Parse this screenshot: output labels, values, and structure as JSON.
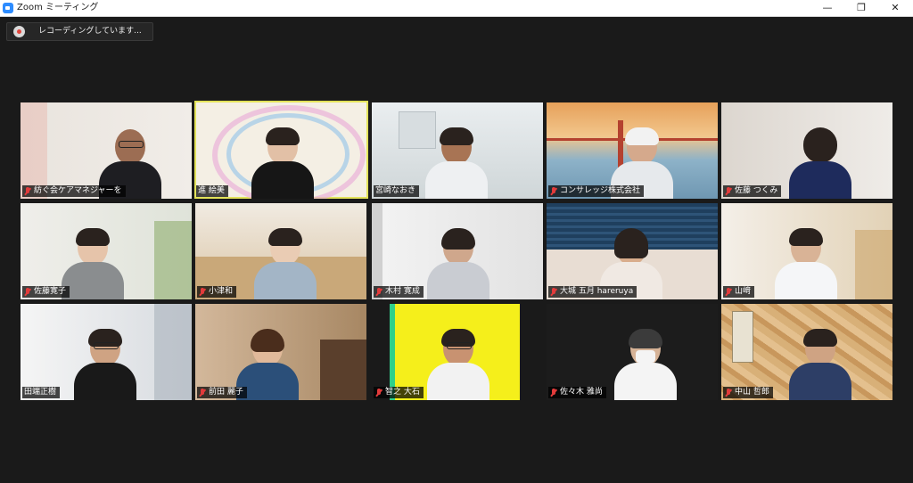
{
  "window": {
    "title": "Zoom ミーティング",
    "minimize": "—",
    "restore": "❐",
    "close": "✕"
  },
  "recording": {
    "label": "レコーディングしています..."
  },
  "participants": [
    {
      "name": "紡ぐ会ケアマネジャーを",
      "active": false
    },
    {
      "name": "進 絵美",
      "active": true
    },
    {
      "name": "宮崎なおき",
      "active": false
    },
    {
      "name": "コンサレッジ株式会社",
      "active": false
    },
    {
      "name": "佐藤 つくみ",
      "active": false
    },
    {
      "name": "佐藤寛子",
      "active": false
    },
    {
      "name": "小津和",
      "active": false
    },
    {
      "name": "木村 寛成",
      "active": false
    },
    {
      "name": "大城 五月 hareruya",
      "active": false
    },
    {
      "name": "山﨑",
      "active": false
    },
    {
      "name": "田端正樹",
      "active": false
    },
    {
      "name": "前田 麗子",
      "active": false
    },
    {
      "name": "智之 大石",
      "active": false
    },
    {
      "name": "佐々木 雅尚",
      "active": false
    },
    {
      "name": "中山 哲郎",
      "active": false
    }
  ],
  "colors": {
    "active_border": "#e3e35a",
    "muted_mic": "#e23b3b",
    "gallery_bg": "#1a1a1a"
  }
}
